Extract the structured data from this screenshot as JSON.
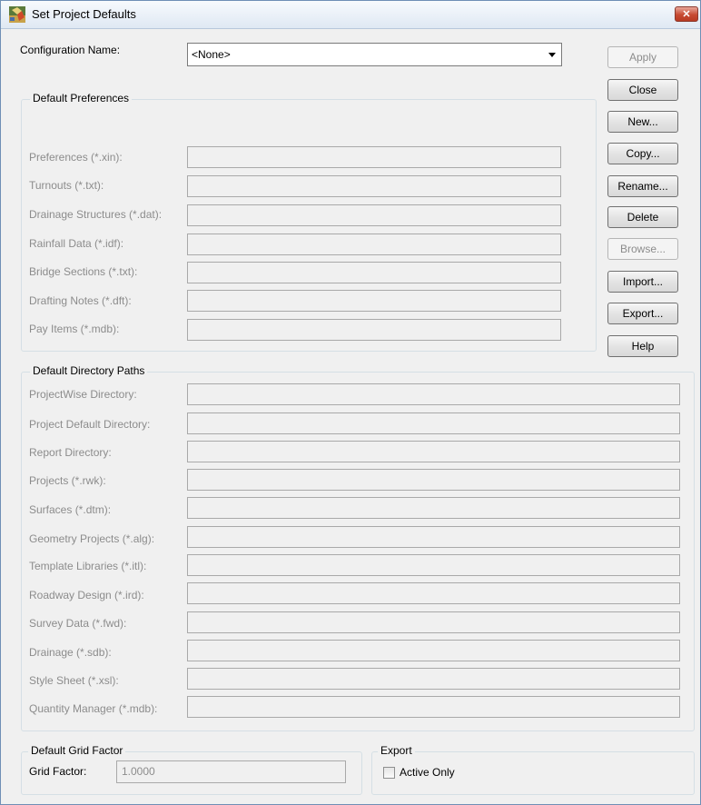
{
  "window": {
    "title": "Set Project Defaults",
    "close_glyph": "✕"
  },
  "config": {
    "label": "Configuration Name:",
    "value": "<None>"
  },
  "buttons": {
    "apply": "Apply",
    "close": "Close",
    "new": "New...",
    "copy": "Copy...",
    "rename": "Rename...",
    "delete": "Delete",
    "browse": "Browse...",
    "import": "Import...",
    "export": "Export...",
    "help": "Help"
  },
  "preferences": {
    "title": "Default Preferences",
    "items": [
      {
        "label": "Preferences (*.xin):",
        "value": ""
      },
      {
        "label": "Turnouts (*.txt):",
        "value": ""
      },
      {
        "label": "Drainage Structures (*.dat):",
        "value": ""
      },
      {
        "label": "Rainfall Data (*.idf):",
        "value": ""
      },
      {
        "label": "Bridge Sections (*.txt):",
        "value": ""
      },
      {
        "label": "Drafting Notes (*.dft):",
        "value": ""
      },
      {
        "label": "Pay Items (*.mdb):",
        "value": ""
      }
    ]
  },
  "directories": {
    "title": "Default Directory Paths",
    "items": [
      {
        "label": "ProjectWise Directory:",
        "value": ""
      },
      {
        "label": "Project Default Directory:",
        "value": ""
      },
      {
        "label": "Report Directory:",
        "value": ""
      },
      {
        "label": "Projects (*.rwk):",
        "value": ""
      },
      {
        "label": "Surfaces (*.dtm):",
        "value": ""
      },
      {
        "label": "Geometry Projects (*.alg):",
        "value": ""
      },
      {
        "label": "Template Libraries (*.itl):",
        "value": ""
      },
      {
        "label": "Roadway Design (*.ird):",
        "value": ""
      },
      {
        "label": "Survey Data (*.fwd):",
        "value": ""
      },
      {
        "label": "Drainage (*.sdb):",
        "value": ""
      },
      {
        "label": "Style Sheet (*.xsl):",
        "value": ""
      },
      {
        "label": "Quantity Manager (*.mdb):",
        "value": ""
      }
    ]
  },
  "grid": {
    "title": "Default Grid Factor",
    "label": "Grid Factor:",
    "value": "1.0000"
  },
  "export": {
    "title": "Export",
    "active_only_label": "Active Only",
    "active_only_checked": false
  },
  "colors": {
    "disabled_text": "#8c8c8c",
    "close_red": "#c74a32",
    "window_bg": "#f0f0f0"
  },
  "icons": {
    "app": "app-icon",
    "close": "close-icon",
    "dropdown": "chevron-down-icon"
  }
}
